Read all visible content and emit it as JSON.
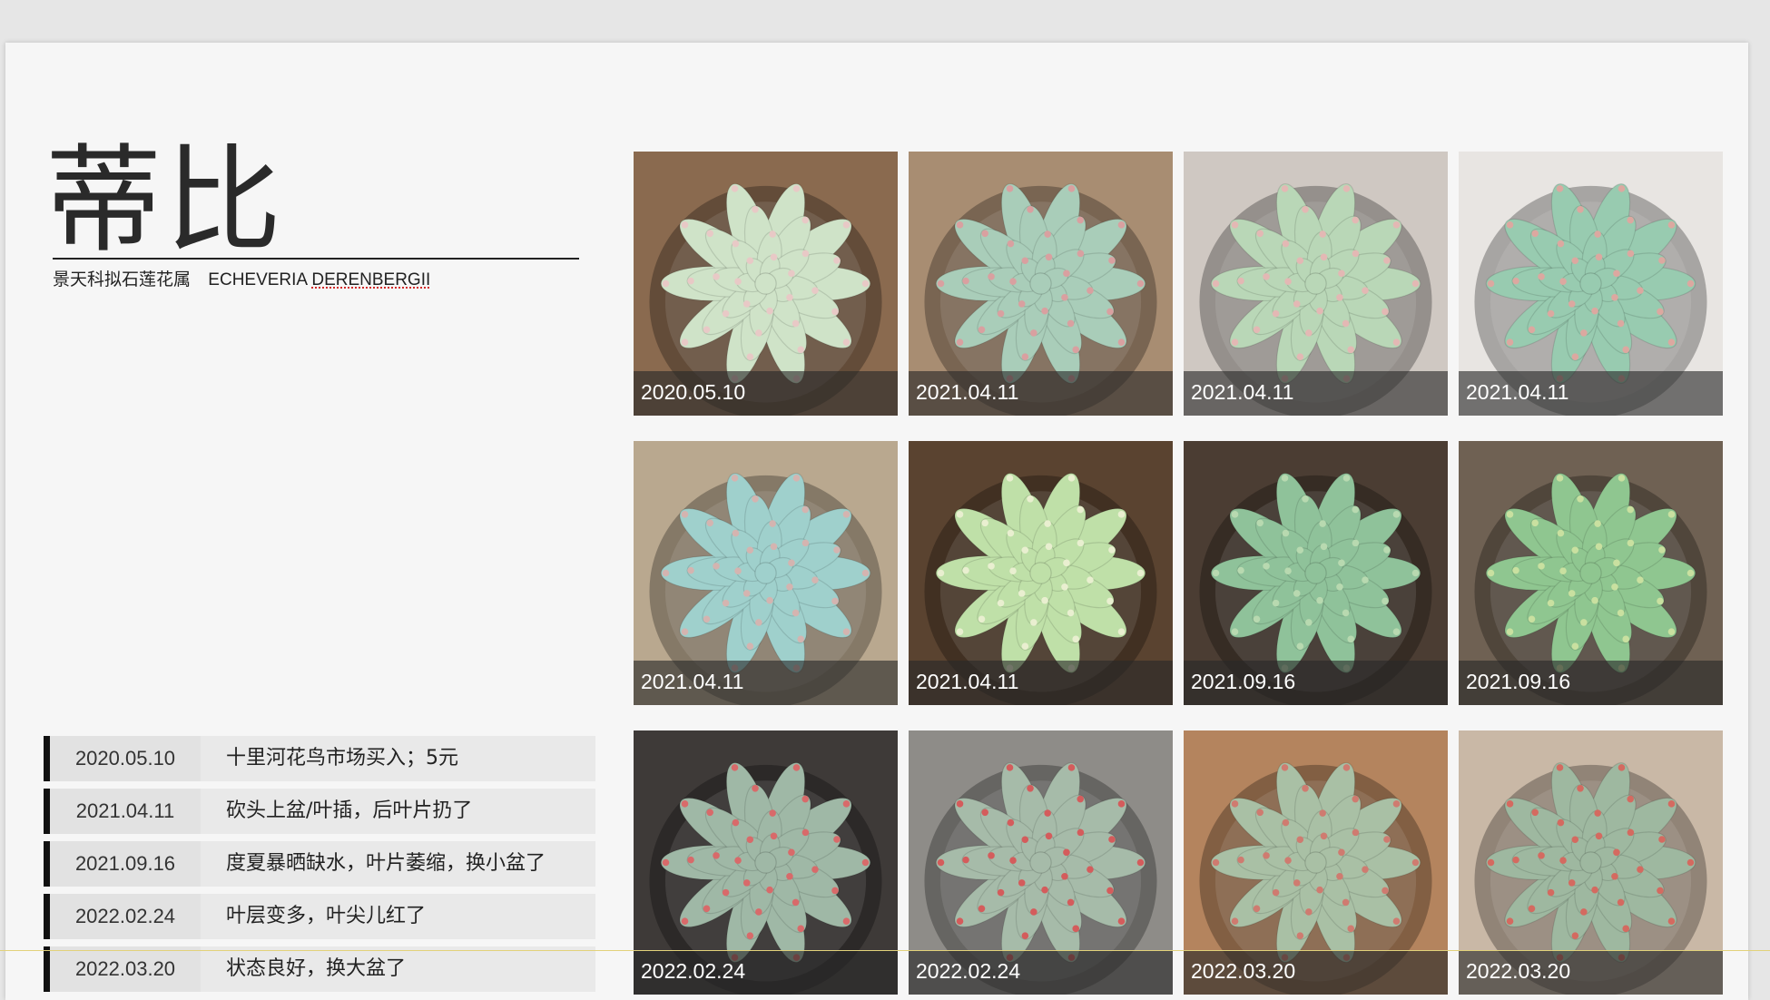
{
  "title": "蒂比",
  "subtitle": {
    "genus_cn": "景天科拟石莲花属",
    "latin_word1": "ECHEVERIA",
    "latin_word2": "DERENBERGII"
  },
  "timeline": [
    {
      "date": "2020.05.10",
      "text": "十里河花鸟市场买入；5元"
    },
    {
      "date": "2021.04.11",
      "text": "砍头上盆/叶插，后叶片扔了"
    },
    {
      "date": "2021.09.16",
      "text": "度夏暴晒缺水，叶片萎缩，换小盆了"
    },
    {
      "date": "2022.02.24",
      "text": "叶层变多，叶尖儿红了"
    },
    {
      "date": "2022.03.20",
      "text": "状态良好，换大盆了"
    }
  ],
  "photos": [
    {
      "caption": "2020.05.10",
      "bg": "#8a6a4f",
      "plant": "#cfe3c8",
      "tip": "#e8c9c6"
    },
    {
      "caption": "2021.04.11",
      "bg": "#a88d72",
      "plant": "#a9cdb9",
      "tip": "#d9a0a0"
    },
    {
      "caption": "2021.04.11",
      "bg": "#cfc8c2",
      "plant": "#b9d7b7",
      "tip": "#e3b8b4"
    },
    {
      "caption": "2021.04.11",
      "bg": "#e8e5e2",
      "plant": "#98cbb0",
      "tip": "#dca8a0"
    },
    {
      "caption": "2021.04.11",
      "bg": "#b9a88f",
      "plant": "#9fd0cc",
      "tip": "#d4b4b0"
    },
    {
      "caption": "2021.04.11",
      "bg": "#5a4330",
      "plant": "#bfe0a8",
      "tip": "#e9efd0"
    },
    {
      "caption": "2021.09.16",
      "bg": "#4b3d33",
      "plant": "#8fc29a",
      "tip": "#b8d9b0"
    },
    {
      "caption": "2021.09.16",
      "bg": "#6f6153",
      "plant": "#8fc690",
      "tip": "#c9e0a0"
    },
    {
      "caption": "2022.02.24",
      "bg": "#3e3a38",
      "plant": "#9fb8a6",
      "tip": "#d86a6a"
    },
    {
      "caption": "2022.02.24",
      "bg": "#8e8c88",
      "plant": "#a6bba9",
      "tip": "#d45c5c"
    },
    {
      "caption": "2022.03.20",
      "bg": "#b4845e",
      "plant": "#a9c0a5",
      "tip": "#cf7b70"
    },
    {
      "caption": "2022.03.20",
      "bg": "#c9b8a6",
      "plant": "#9eb8a0",
      "tip": "#d46a60"
    }
  ]
}
